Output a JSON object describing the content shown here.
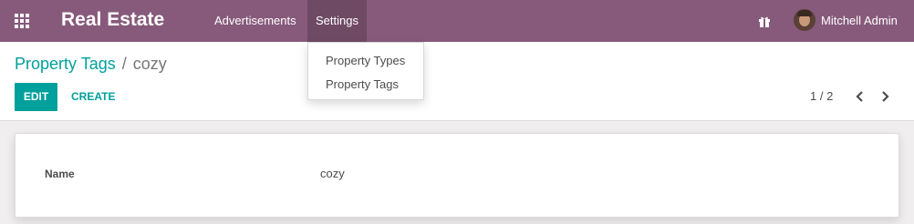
{
  "navbar": {
    "app_name": "Real Estate",
    "menu": [
      {
        "label": "Advertisements"
      },
      {
        "label": "Settings"
      }
    ],
    "user_name": "Mitchell Admin"
  },
  "settings_dropdown": {
    "items": [
      {
        "label": "Property Types"
      },
      {
        "label": "Property Tags"
      }
    ]
  },
  "breadcrumb": {
    "parent": "Property Tags",
    "separator": "/",
    "current": "cozy"
  },
  "buttons": {
    "edit": "EDIT",
    "create": "CREATE"
  },
  "pager": {
    "value": "1 / 2"
  },
  "form": {
    "fields": [
      {
        "label": "Name",
        "value": "cozy"
      }
    ]
  },
  "colors": {
    "navbar": "#875a7b",
    "active_menu": "#6f4a65",
    "primary": "#00a09d"
  },
  "icons": [
    "apps-grid-icon",
    "gift-icon",
    "chevron-left-icon",
    "chevron-right-icon"
  ]
}
